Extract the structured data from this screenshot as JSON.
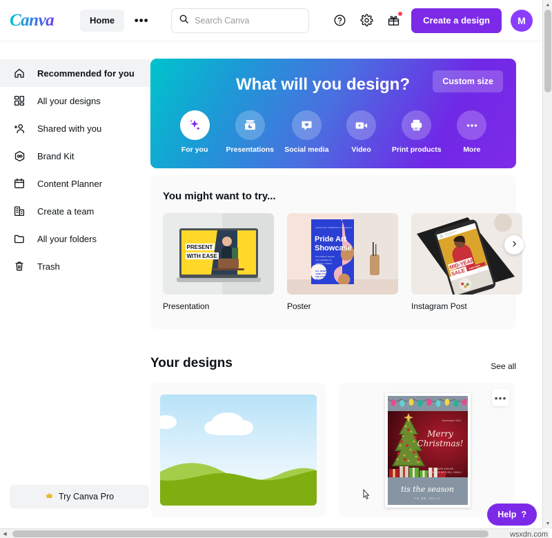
{
  "header": {
    "logo_text": "Canva",
    "home_label": "Home",
    "more_label": "•••",
    "search_placeholder": "Search Canva",
    "search_value": "",
    "help_icon": "question-circle-icon",
    "settings_icon": "gear-icon",
    "gift_icon": "gift-icon",
    "create_label": "Create a design",
    "avatar_initial": "M"
  },
  "sidebar": {
    "items": [
      {
        "label": "Recommended for you",
        "icon": "home-icon",
        "active": true
      },
      {
        "label": "All your designs",
        "icon": "grid-icon",
        "active": false
      },
      {
        "label": "Shared with you",
        "icon": "add-person-icon",
        "active": false
      },
      {
        "label": "Brand Kit",
        "icon": "brand-hexagon-icon",
        "active": false
      },
      {
        "label": "Content Planner",
        "icon": "calendar-icon",
        "active": false
      },
      {
        "label": "Create a team",
        "icon": "building-icon",
        "active": false
      },
      {
        "label": "All your folders",
        "icon": "folder-icon",
        "active": false
      },
      {
        "label": "Trash",
        "icon": "trash-icon",
        "active": false
      }
    ],
    "pro_button": {
      "label": "Try Canva Pro",
      "icon": "crown-icon"
    }
  },
  "hero": {
    "title": "What will you design?",
    "custom_size_label": "Custom size",
    "gradient_from": "#00C4CC",
    "gradient_to": "#7D2AE8",
    "categories": [
      {
        "label": "For you",
        "icon": "sparkles-icon",
        "active": true
      },
      {
        "label": "Presentations",
        "icon": "presentation-icon",
        "active": false
      },
      {
        "label": "Social media",
        "icon": "chat-heart-icon",
        "active": false
      },
      {
        "label": "Video",
        "icon": "video-camera-icon",
        "active": false
      },
      {
        "label": "Print products",
        "icon": "printer-icon",
        "active": false
      },
      {
        "label": "More",
        "icon": "ellipsis-icon",
        "active": false
      }
    ]
  },
  "try_section": {
    "title": "You might want to try...",
    "cards": [
      {
        "label": "Presentation",
        "thumb_text_line1": "PRESENT",
        "thumb_text_line2": "WITH EASE"
      },
      {
        "label": "Poster",
        "thumb_text_line1": "Pride Art",
        "thumb_text_line2": "Showcase"
      },
      {
        "label": "Instagram Post",
        "thumb_text_line1": "MID-YEAR",
        "thumb_text_line2": "SALE"
      }
    ],
    "next_arrow_icon": "chevron-right-icon"
  },
  "your_designs": {
    "title": "Your designs",
    "see_all_label": "See all",
    "cards": [
      {
        "name": "landscape-design",
        "more_label": "•••"
      },
      {
        "name": "christmas-card-design",
        "more_label": "•••",
        "date_text": "December 2021",
        "greeting_line1": "Merry",
        "greeting_line2": "Christmas!",
        "wishes_line1": "WARM WISHES",
        "wishes_line2": "FROM THE MITCHELL FAMILY",
        "footer_script": "tis the season",
        "footer_caps": "TO BE JOLLY"
      }
    ]
  },
  "help": {
    "label": "Help",
    "mark": "?"
  },
  "watermark": {
    "text": "wsxdn.com"
  },
  "colors": {
    "brand_purple": "#7D2AE8",
    "brand_teal": "#00C4CC",
    "active_bg": "#F2F3F5"
  }
}
